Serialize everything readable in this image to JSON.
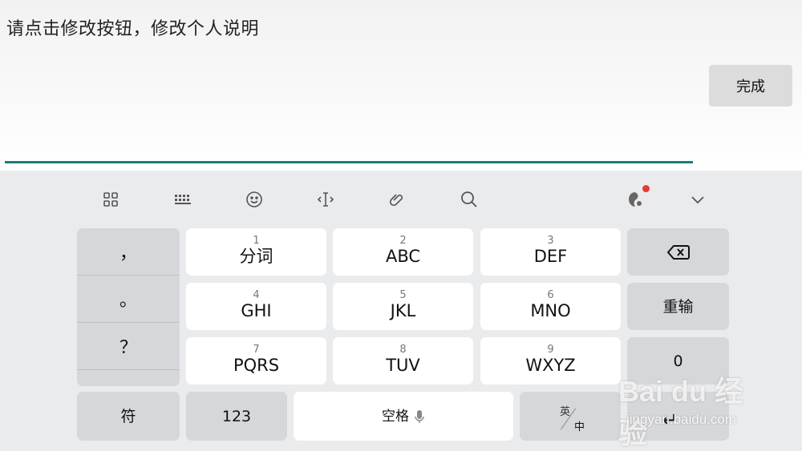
{
  "editor": {
    "text": "请点击修改按钮，修改个人说明",
    "done_label": "完成"
  },
  "toolbar": {
    "icons": [
      "grid-icon",
      "keyboard-layout-icon",
      "emoji-icon",
      "cursor-icon",
      "clipboard-icon",
      "search-icon",
      "ime-logo-icon",
      "collapse-icon"
    ]
  },
  "keyboard": {
    "punctuation": [
      "，",
      "。",
      "？"
    ],
    "t9": [
      {
        "num": "1",
        "label": "分词"
      },
      {
        "num": "2",
        "label": "ABC"
      },
      {
        "num": "3",
        "label": "DEF"
      },
      {
        "num": "4",
        "label": "GHI"
      },
      {
        "num": "5",
        "label": "JKL"
      },
      {
        "num": "6",
        "label": "MNO"
      },
      {
        "num": "7",
        "label": "PQRS"
      },
      {
        "num": "8",
        "label": "TUV"
      },
      {
        "num": "9",
        "label": "WXYZ"
      }
    ],
    "reenter_label": "重输",
    "zero_label": "0",
    "symbol_label": "符",
    "numeric_label": "123",
    "space_label": "空格",
    "lang_en": "英",
    "lang_zh": "中",
    "enter_symbol": "↵"
  },
  "colors": {
    "underline": "#1f7a7a",
    "badge": "#e53935"
  },
  "watermark": {
    "logo": "Bai du 经验",
    "url": "jingyan.baidu.com"
  }
}
